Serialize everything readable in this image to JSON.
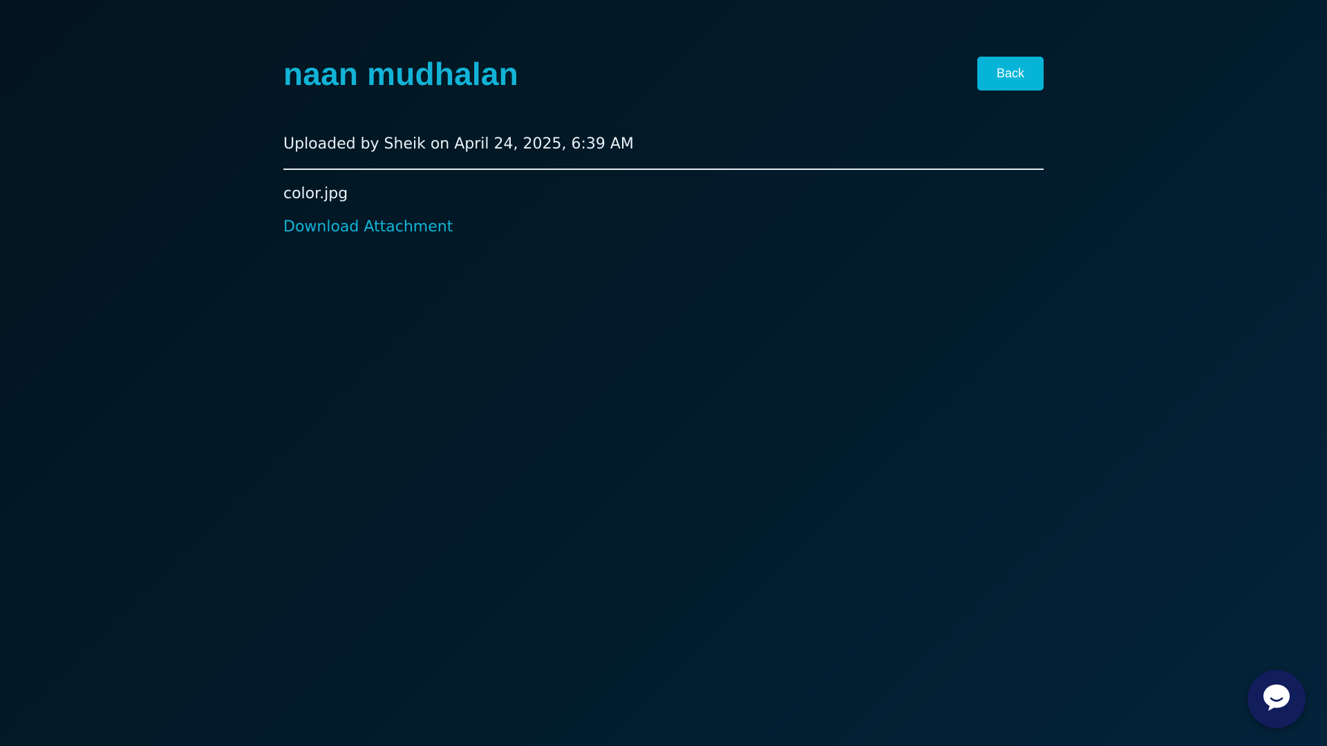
{
  "page": {
    "title": "naan mudhalan",
    "back_label": "Back",
    "uploaded_info": "Uploaded by Sheik on April 24, 2025, 6:39 AM",
    "file_name": "color.jpg",
    "download_label": "Download Attachment"
  },
  "chat_widget": {
    "icon": "chat-bubble-icon"
  },
  "colors": {
    "accent": "#12b3d6",
    "button_bg": "#06b4d8",
    "chat_bg": "#121d5c",
    "text": "#e8f2f7"
  }
}
